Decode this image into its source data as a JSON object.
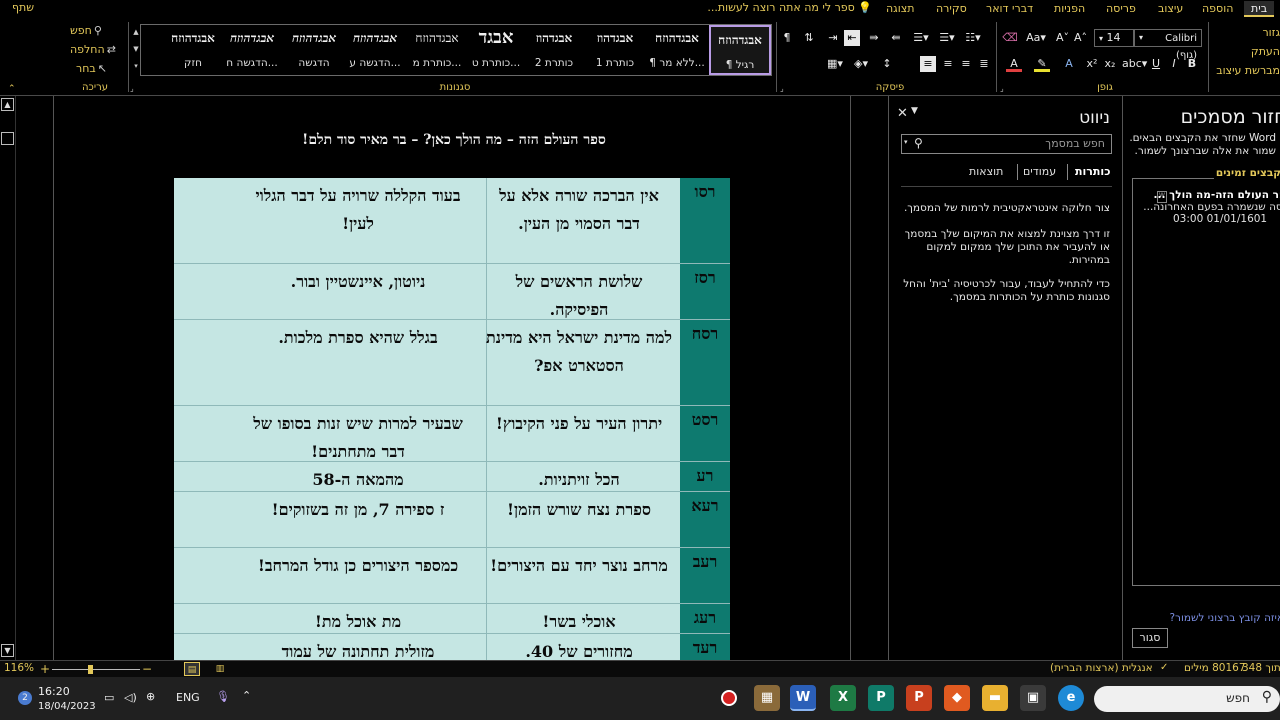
{
  "tabs": {
    "home": "בית",
    "insert": "הוספה",
    "design": "עיצוב",
    "layout": "פריסה",
    "references": "הפניות",
    "mailings": "דברי דואר",
    "review": "סקירה",
    "view": "תצוגה",
    "tell_me": "ספר לי מה אתה רוצה לעשות...",
    "share": "שתף"
  },
  "ribbon": {
    "groups": {
      "editing": "עריכה",
      "styles": "סגנונות",
      "paragraph": "פיסקה",
      "font": "גופן"
    },
    "editing": {
      "find": "חפש",
      "replace": "החלפה",
      "select": "בחר"
    },
    "font": {
      "name": "Calibri (גוף)",
      "size": "14"
    },
    "right_labels": {
      "cut": "גזור",
      "copy": "העתק",
      "format_painter": "מברשת עיצוב"
    },
    "styles": [
      {
        "sample": "אבגדהוזח",
        "name": "¶ רגיל",
        "selected": true
      },
      {
        "sample": "אבגדהוזח",
        "name": "¶ ללא מר..."
      },
      {
        "sample": "אבגדהוז",
        "name": "כותרת 1"
      },
      {
        "sample": "אבגדהוז",
        "name": "כותרת 2"
      },
      {
        "sample": "אבגד",
        "name": "כותרת ט..."
      },
      {
        "sample": "אבגדהוזח",
        "name": "כותרת מ..."
      },
      {
        "sample": "אבגדהוזח",
        "name": "הדגשה ע..."
      },
      {
        "sample": "אבגדהוזח",
        "name": "הדגשה"
      },
      {
        "sample": "אבגדהוזח",
        "name": "הדגשה ח..."
      },
      {
        "sample": "אבגדהוזח",
        "name": "חזק"
      }
    ]
  },
  "document": {
    "title": "ספר העולם הזה – מה הולך כאן? – בר מאיר סוד תלם!",
    "rows": [
      {
        "num": "רסו",
        "a": "אין הברכה שורה אלא על דבר הסמוי מן העין.",
        "b": "בעוד הקללה שרויה על דבר הגלוי לעין!"
      },
      {
        "num": "רסז",
        "a": "שלושת הראשים של הפיסיקה.",
        "b": "ניוטון, איינשטיין ובור."
      },
      {
        "num": "רסח",
        "a": "למה מדינת ישראל היא מדינת הסטארט אפ?",
        "b": "בגלל שהיא ספרת מלכות."
      },
      {
        "num": "רסט",
        "a": "יתרון העיר על פני הקיבוץ!",
        "b": "שבעיר למרות שיש זנות בסופו של דבר מתחתנים!"
      },
      {
        "num": "רע",
        "a": "הכל זויתניות.",
        "b": "מהמאה ה-58"
      },
      {
        "num": "רעא",
        "a": "ספרת נצח שורש הזמן!",
        "b": "ז ספירה 7, מן זה בשזוקים!"
      },
      {
        "num": "רעב",
        "a": "מרחב נוצר יחד עם היצורים!",
        "b": "כמספר היצורים כן גודל המרחב!"
      },
      {
        "num": "רעג",
        "a": "אוכלי בשר!",
        "b": "מת אוכל מת!"
      },
      {
        "num": "רעד",
        "a": "מחזורים של 40.",
        "b": "מזולית תחתונה של עמוד"
      }
    ]
  },
  "navigation": {
    "title": "ניווט",
    "search_placeholder": "חפש במסמך",
    "tabs": {
      "headings": "כותרות",
      "pages": "עמודים",
      "results": "תוצאות"
    },
    "paragraphs": [
      "צור חלוקה אינטראקטיבית לרמות של המסמך.",
      "זו דרך מצוינת למצוא את המיקום שלך במסמך או להעביר את התוכן שלך ממקום למקום במהירות.",
      "כדי להתחיל לעבוד, עבור לכרטיסיה 'בית' והחל סגנונות כותרת על הכותרות במסמך."
    ]
  },
  "recovery": {
    "title": "שחזור מסמכים",
    "desc": "Word שחזר את הקבצים הבאים. שמור את אלה שברצונך לשמור.",
    "header": "קבצים זמינים",
    "item_title": "ספר העולם הזה-מה הולך ...",
    "item_sub": "גרסה שנשמרה בפעם האחרונה...",
    "item_date": "03:00 01/01/1601",
    "question": "באיזה קובץ ברצוני לשמור?",
    "close": "סגור"
  },
  "status": {
    "page": "עמוד 31 מתוך 348",
    "words": "80167 מילים",
    "language": "אנגלית (ארצות הברית)",
    "zoom": "116%"
  },
  "taskbar": {
    "time": "16:20",
    "date": "18/04/2023",
    "lang": "ENG",
    "search": "חפש",
    "notif_count": "2"
  },
  "colors": {
    "accent": "#e3c85a",
    "teal": "#0e7a6f",
    "cell_bg": "#c5e6e3"
  }
}
